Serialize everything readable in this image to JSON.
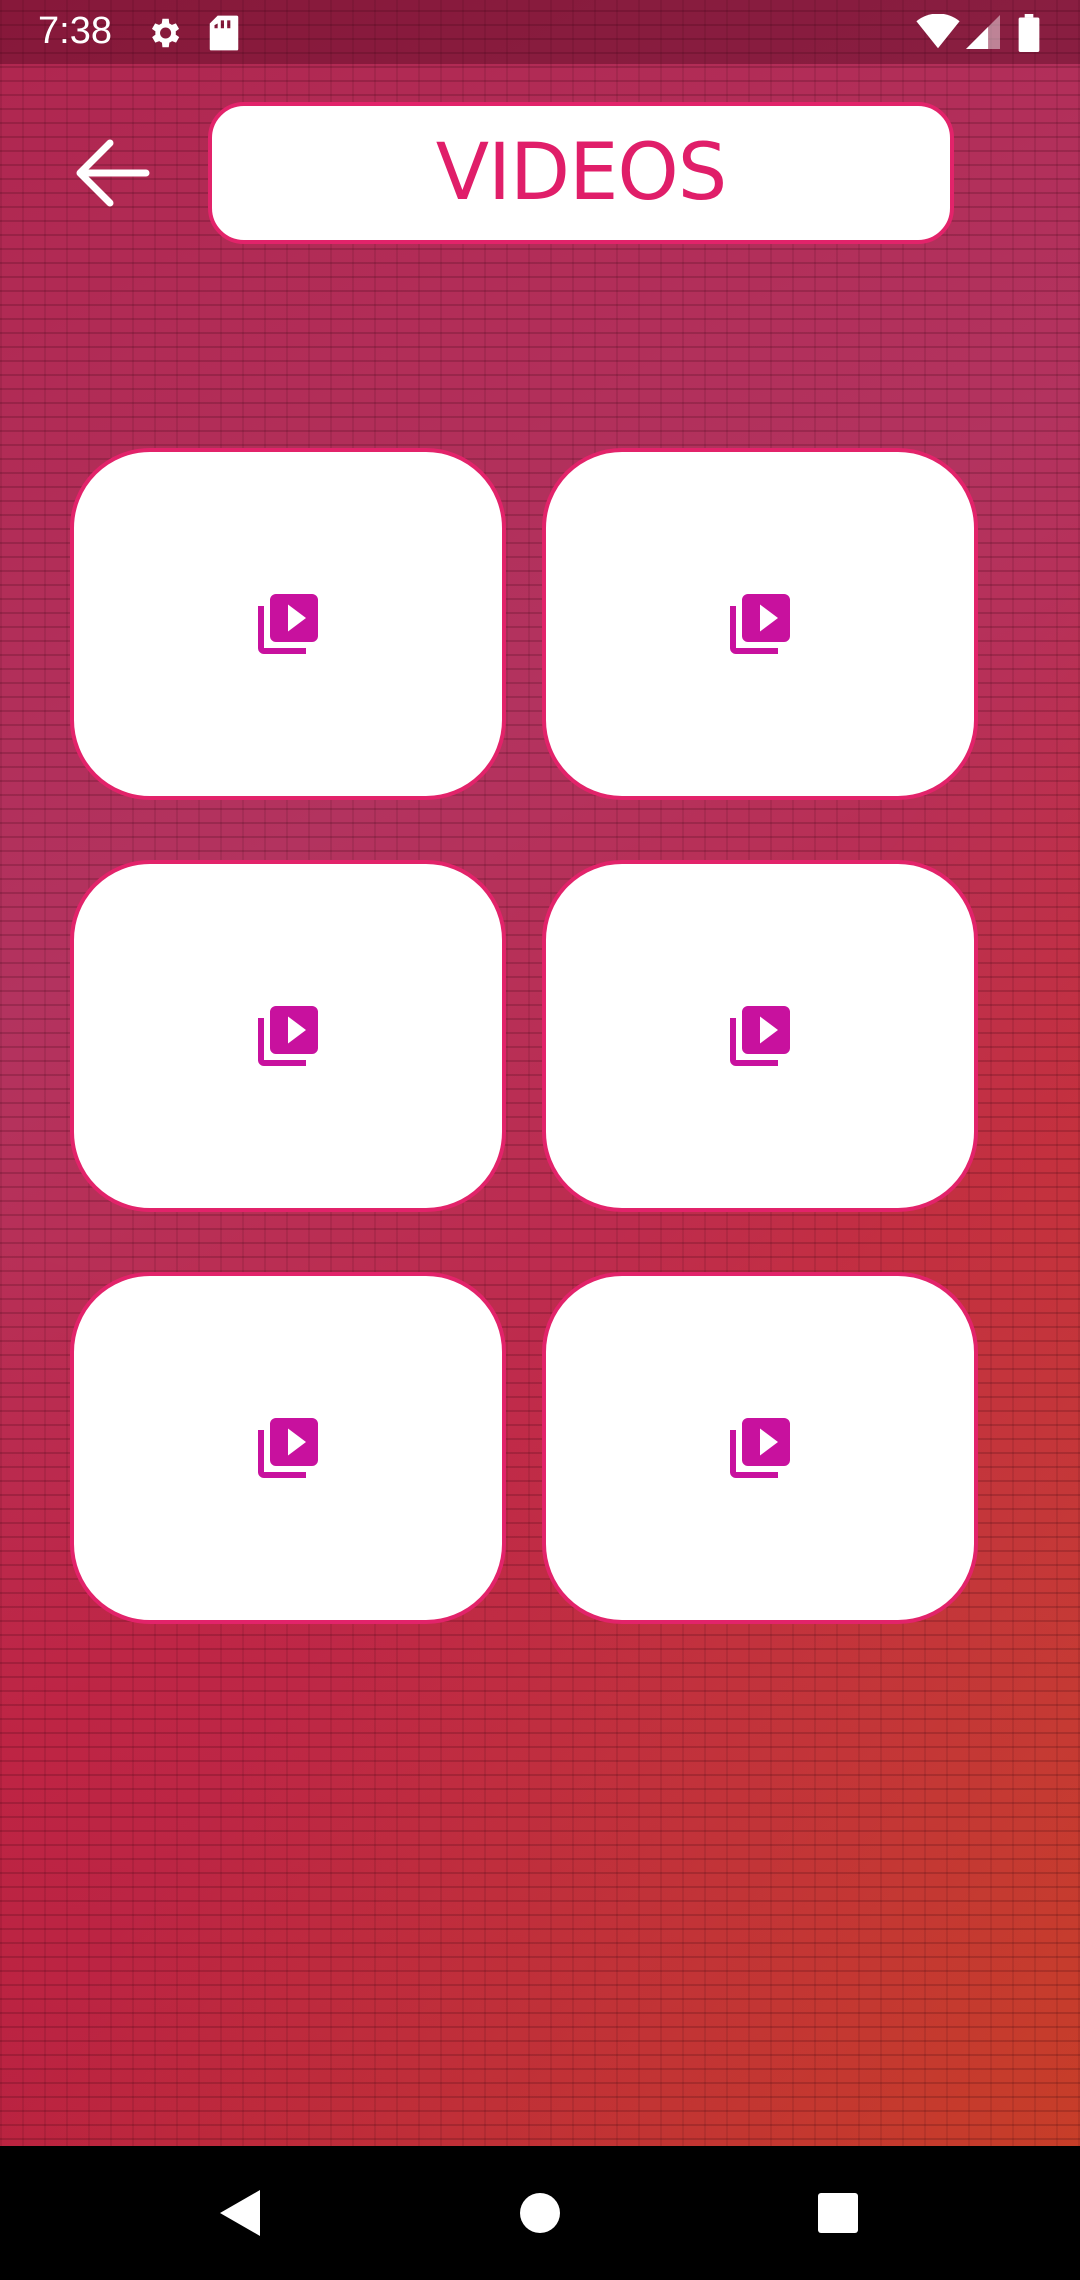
{
  "status_bar": {
    "time": "7:38",
    "icons": [
      "gear-icon",
      "sd-card-icon",
      "wifi-icon",
      "signal-icon",
      "battery-icon"
    ]
  },
  "header": {
    "title": "VIDEOS",
    "back_icon": "back-arrow-icon"
  },
  "video_tiles": [
    {
      "icon": "video-library-icon"
    },
    {
      "icon": "video-library-icon"
    },
    {
      "icon": "video-library-icon"
    },
    {
      "icon": "video-library-icon"
    },
    {
      "icon": "video-library-icon"
    },
    {
      "icon": "video-library-icon"
    }
  ],
  "nav_bar": {
    "buttons": [
      "back-triangle-icon",
      "home-circle-icon",
      "recents-square-icon"
    ]
  },
  "colors": {
    "accent": "#e01e69",
    "icon": "#c8119e",
    "tile_border": "#e2236a"
  }
}
